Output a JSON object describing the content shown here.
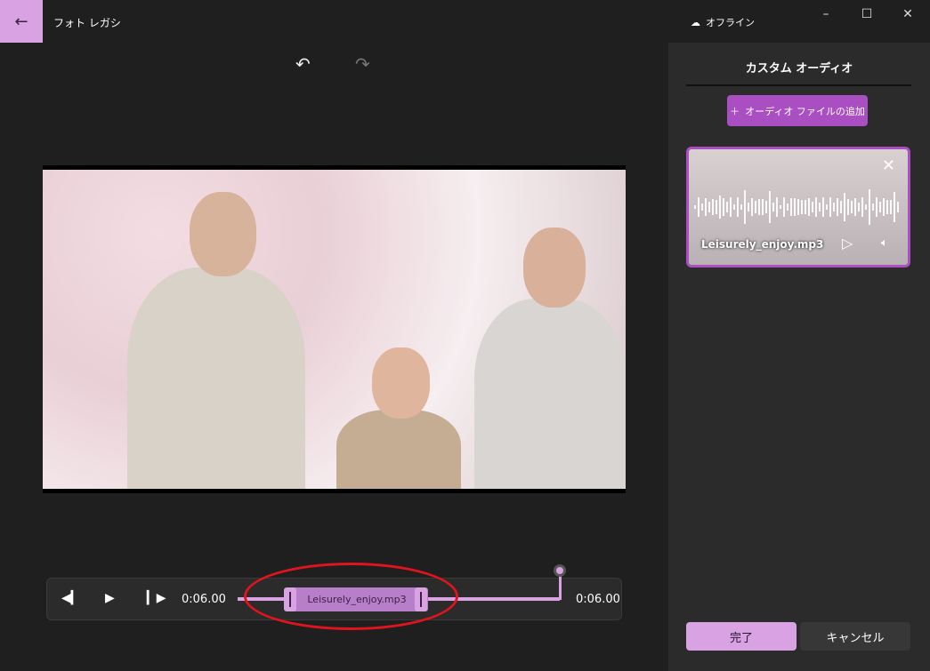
{
  "app": {
    "title": "フォト レガシ",
    "offline_label": "オフライン"
  },
  "window": {
    "minimize": "–",
    "maximize": "☐",
    "close": "✕"
  },
  "toolbar": {
    "undo": "↶",
    "redo": "↷"
  },
  "panel": {
    "title": "カスタム オーディオ",
    "add_button": "オーディオ ファイルの追加",
    "audio_card": {
      "filename": "Leisurely_enjoy.mp3"
    },
    "done": "完了",
    "cancel": "キャンセル"
  },
  "player": {
    "current_time": "0:06.00",
    "total_time": "0:06.00",
    "clip_label": "Leisurely_enjoy.mp3"
  },
  "colors": {
    "accent": "#d9a3e3",
    "button": "#a94fc2",
    "annotation": "#e0141e"
  }
}
